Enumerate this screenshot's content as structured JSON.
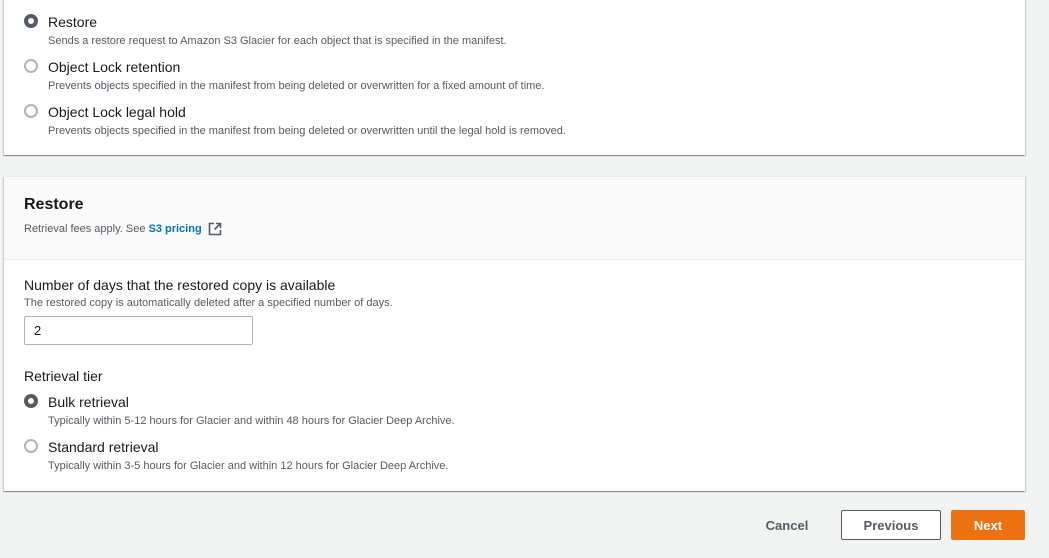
{
  "operations": [
    {
      "label": "Restore",
      "description": "Sends a restore request to Amazon S3 Glacier for each object that is specified in the manifest.",
      "checked": true
    },
    {
      "label": "Object Lock retention",
      "description": "Prevents objects specified in the manifest from being deleted or overwritten for a fixed amount of time.",
      "checked": false
    },
    {
      "label": "Object Lock legal hold",
      "description": "Prevents objects specified in the manifest from being deleted or overwritten until the legal hold is removed.",
      "checked": false
    }
  ],
  "restore": {
    "title": "Restore",
    "fees_text": "Retrieval fees apply. See",
    "pricing_link": "S3 pricing",
    "days_label": "Number of days that the restored copy is available",
    "days_description": "The restored copy is automatically deleted after a specified number of days.",
    "days_value": "2",
    "tier_label": "Retrieval tier",
    "tiers": [
      {
        "label": "Bulk retrieval",
        "description": "Typically within 5-12 hours for Glacier and within 48 hours for Glacier Deep Archive.",
        "checked": true
      },
      {
        "label": "Standard retrieval",
        "description": "Typically within 3-5 hours for Glacier and within 12 hours for Glacier Deep Archive.",
        "checked": false
      }
    ]
  },
  "footer": {
    "cancel_label": "Cancel",
    "previous_label": "Previous",
    "next_label": "Next"
  },
  "colors": {
    "accent": "#ec7211",
    "link": "#0073bb"
  },
  "icons": {
    "external_link": "external-link-icon"
  }
}
